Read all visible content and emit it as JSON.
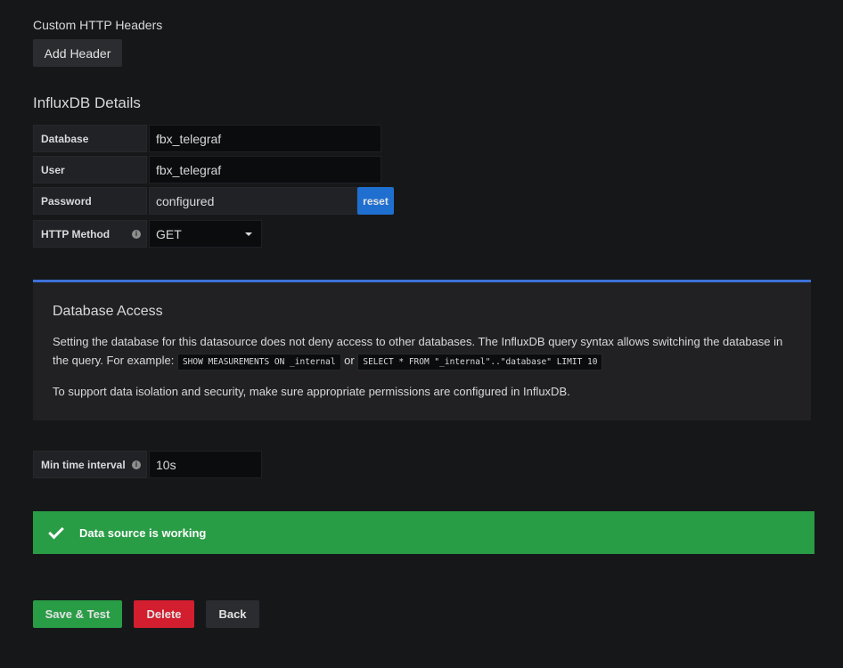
{
  "headers": {
    "title": "Custom HTTP Headers",
    "add_button": "Add Header"
  },
  "influx": {
    "title": "InfluxDB Details",
    "database": {
      "label": "Database",
      "value": "fbx_telegraf"
    },
    "user": {
      "label": "User",
      "value": "fbx_telegraf"
    },
    "password": {
      "label": "Password",
      "value": "configured",
      "reset": "reset"
    },
    "method": {
      "label": "HTTP Method",
      "value": "GET"
    }
  },
  "access": {
    "title": "Database Access",
    "text1": "Setting the database for this datasource does not deny access to other databases. The InfluxDB query syntax allows switching the database in the query. For example:",
    "code1": "SHOW MEASUREMENTS ON _internal",
    "or": "or",
    "code2": "SELECT * FROM \"_internal\"..\"database\" LIMIT 10",
    "text2": "To support data isolation and security, make sure appropriate permissions are configured in InfluxDB."
  },
  "interval": {
    "label": "Min time interval",
    "value": "10s"
  },
  "status": {
    "text": "Data source is working",
    "color": "#299c46"
  },
  "actions": {
    "save": "Save & Test",
    "delete": "Delete",
    "back": "Back"
  }
}
